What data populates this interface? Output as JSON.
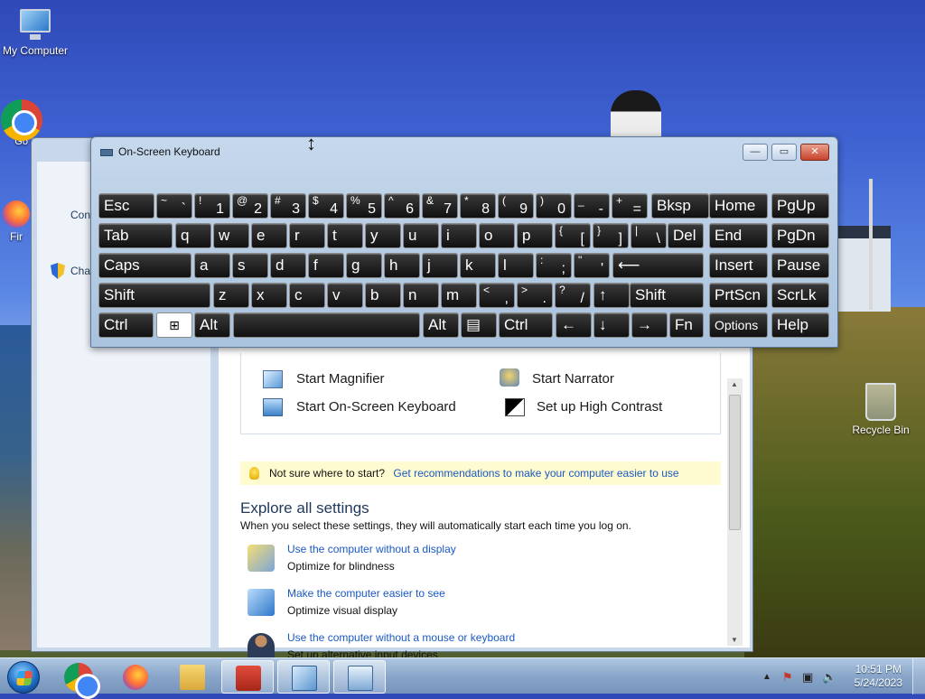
{
  "desktop": {
    "icons": [
      {
        "label": "My Computer"
      },
      {
        "label": "Go Chr"
      },
      {
        "label": "Fir"
      },
      {
        "label": "Recycle Bin"
      }
    ]
  },
  "ease_of_access_window": {
    "sidebar": {
      "item_1": "Contr",
      "item_2": "Chan"
    },
    "quick_access": {
      "start_magnifier": "Start Magnifier",
      "start_narrator": "Start Narrator",
      "start_osk": "Start On-Screen Keyboard",
      "setup_high_contrast": "Set up High Contrast"
    },
    "tip": {
      "text": "Not sure where to start?",
      "link": "Get recommendations to make your computer easier to use"
    },
    "explore": {
      "title": "Explore all settings",
      "description": "When you select these settings, they will automatically start each time you log on."
    },
    "settings": [
      {
        "link": "Use the computer without a display",
        "sub": "Optimize for blindness"
      },
      {
        "link": "Make the computer easier to see",
        "sub": "Optimize visual display"
      },
      {
        "link": "Use the computer without a mouse or keyboard",
        "sub": "Set up alternative input devices"
      }
    ]
  },
  "osk": {
    "title": "On-Screen Keyboard",
    "controls": {
      "minimize": "—",
      "maximize": "▭",
      "close": "✕"
    },
    "keys": {
      "esc": "Esc",
      "backspace": "Bksp",
      "home": "Home",
      "pgup": "PgUp",
      "tab": "Tab",
      "del": "Del",
      "end": "End",
      "pgdn": "PgDn",
      "caps": "Caps",
      "insert": "Insert",
      "pause": "Pause",
      "shift_left": "Shift",
      "shift_right": "Shift",
      "prtscn": "PrtScn",
      "scrlk": "ScrLk",
      "ctrl_left": "Ctrl",
      "alt_left": "Alt",
      "alt_right": "Alt",
      "ctrl_right": "Ctrl",
      "fn": "Fn",
      "options": "Options",
      "help": "Help",
      "enter_arrow": "⟵",
      "up_arrow": "↑",
      "left_arrow": "←",
      "down_arrow": "↓",
      "right_arrow": "→",
      "row1": [
        [
          "~",
          "`"
        ],
        [
          "!",
          "1"
        ],
        [
          "@",
          "2"
        ],
        [
          "#",
          "3"
        ],
        [
          "$",
          "4"
        ],
        [
          "%",
          "5"
        ],
        [
          "^",
          "6"
        ],
        [
          "&",
          "7"
        ],
        [
          "*",
          "8"
        ],
        [
          "(",
          "9"
        ],
        [
          ")",
          "0"
        ],
        [
          "_",
          "-"
        ],
        [
          "+",
          "="
        ]
      ],
      "row2": [
        "q",
        "w",
        "e",
        "r",
        "t",
        "y",
        "u",
        "i",
        "o",
        "p"
      ],
      "row2_sym": [
        [
          "{",
          "["
        ],
        [
          "}",
          "]"
        ],
        [
          "|",
          "\\"
        ]
      ],
      "row3": [
        "a",
        "s",
        "d",
        "f",
        "g",
        "h",
        "j",
        "k",
        "l"
      ],
      "row3_sym": [
        [
          ":",
          ";"
        ],
        [
          "\"",
          "'"
        ]
      ],
      "row4": [
        "z",
        "x",
        "c",
        "v",
        "b",
        "n",
        "m"
      ],
      "row4_sym": [
        [
          "<",
          ","
        ],
        [
          ">",
          "."
        ],
        [
          "?",
          "/"
        ]
      ]
    }
  },
  "taskbar": {
    "time": "10:51 PM",
    "date": "5/24/2023"
  }
}
